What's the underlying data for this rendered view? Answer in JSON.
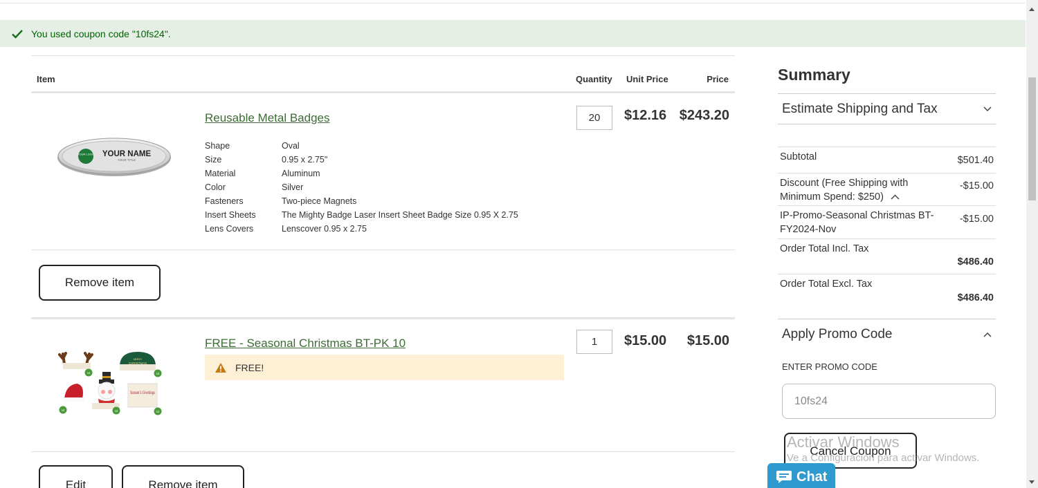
{
  "banner": {
    "message": "You used coupon code \"10fs24\"."
  },
  "cart": {
    "headers": {
      "item": "Item",
      "quantity": "Quantity",
      "unit_price": "Unit Price",
      "price": "Price"
    },
    "items": [
      {
        "name": "Reusable Metal Badges",
        "quantity": "20",
        "unit_price": "$12.16",
        "price": "$243.20",
        "image": {
          "name_text": "YOUR NAME",
          "title_text": "YOUR TITLE",
          "logo_text": "YOUR LOGO"
        },
        "options": [
          {
            "key": "Shape",
            "value": "Oval"
          },
          {
            "key": "Size",
            "value": "0.95 x 2.75\""
          },
          {
            "key": "Material",
            "value": "Aluminum"
          },
          {
            "key": "Color",
            "value": "Silver"
          },
          {
            "key": "Fasteners",
            "value": "Two-piece Magnets"
          },
          {
            "key": "Insert Sheets",
            "value": "The Mighty Badge Laser Insert Sheet Badge Size 0.95 X 2.75"
          },
          {
            "key": "Lens Covers",
            "value": "Lenscover 0.95 x 2.75"
          }
        ],
        "remove_label": "Remove item"
      },
      {
        "name": "FREE - Seasonal Christmas BT-PK 10",
        "quantity": "1",
        "unit_price": "$15.00",
        "price": "$15.00",
        "image": {
          "count_label": "x2",
          "christmas_text": "CHRISTMAS",
          "merry_text": "MERRY",
          "greetings_text": "Season's Greetings"
        },
        "notice": "FREE!",
        "edit_label": "Edit",
        "remove_label": "Remove item"
      }
    ]
  },
  "summary": {
    "title": "Summary",
    "shipping_toggle": "Estimate Shipping and Tax",
    "lines": [
      {
        "label": "Subtotal",
        "value": "$501.40"
      },
      {
        "label": "Discount (Free Shipping with Minimum Spend: $250)",
        "value": "-$15.00"
      },
      {
        "label": "IP-Promo-Seasonal Christmas BT-FY2024-Nov",
        "value": "-$15.00"
      },
      {
        "label": "Order Total Incl. Tax",
        "value": "$486.40"
      },
      {
        "label": "Order Total Excl. Tax",
        "value": "$486.40"
      }
    ],
    "promo": {
      "toggle": "Apply Promo Code",
      "field_label": "ENTER PROMO CODE",
      "value": "10fs24",
      "cancel_label": "Cancel Coupon"
    }
  },
  "watermark": {
    "line1": "Activar Windows",
    "line2": "Ve a Configuración para activar Windows."
  },
  "chat": {
    "label": "Chat"
  },
  "colors": {
    "accent_green": "#3d6b35",
    "banner_bg": "#e5efe5",
    "notice_bg": "#fdf0d5",
    "chat_blue": "#2e9ad0"
  }
}
